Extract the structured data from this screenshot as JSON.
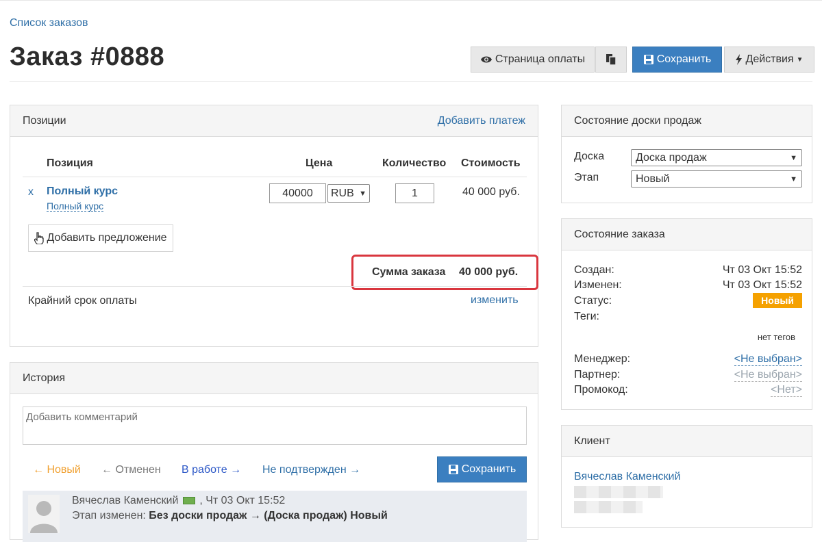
{
  "breadcrumb": "Список заказов",
  "title": "Заказ #0888",
  "toolbar": {
    "pay_page": "Страница оплаты",
    "save": "Сохранить",
    "actions": "Действия"
  },
  "positions": {
    "header": "Позиции",
    "add_payment": "Добавить платеж",
    "columns": {
      "item": "Позиция",
      "price": "Цена",
      "qty": "Количество",
      "cost": "Стоимость"
    },
    "rows": [
      {
        "remove": "x",
        "name": "Полный курс",
        "sub": "Полный курс",
        "price": "40000",
        "currency": "RUB",
        "qty": "1",
        "cost": "40 000 руб."
      }
    ],
    "add_offer": "Добавить предложение",
    "sum_label": "Сумма заказа",
    "sum_value": "40 000 руб.",
    "deadline_label": "Крайний срок оплаты",
    "deadline_edit": "изменить"
  },
  "history": {
    "header": "История",
    "comment_placeholder": "Добавить комментарий",
    "transitions": [
      {
        "label": "← Новый",
        "color": "#f0a030"
      },
      {
        "label": "← Отменен",
        "color": "#777777"
      },
      {
        "label": "В работе →",
        "color": "#2a56c6"
      },
      {
        "label": "Не подтвержден →",
        "color": "#2f6fa7"
      }
    ],
    "save": "Сохранить",
    "entry": {
      "author": "Вячеслав Каменский",
      "date": ", Чт 03 Окт 15:52",
      "prefix": "Этап изменен:",
      "change": "Без доски продаж → (Доска продаж) Новый"
    }
  },
  "board_state": {
    "header": "Состояние доски продаж",
    "board_label": "Доска",
    "board_value": "Доска продаж",
    "stage_label": "Этап",
    "stage_value": "Новый"
  },
  "order_state": {
    "header": "Состояние заказа",
    "created_label": "Создан:",
    "created_value": "Чт 03 Окт 15:52",
    "changed_label": "Изменен:",
    "changed_value": "Чт 03 Окт 15:52",
    "status_label": "Статус:",
    "status_value": "Новый",
    "tags_label": "Теги:",
    "no_tags": "нет тегов",
    "manager_label": "Менеджер:",
    "manager_value": "<Не выбран>",
    "partner_label": "Партнер:",
    "partner_value": "<Не выбран>",
    "promo_label": "Промокод:",
    "promo_value": "<Нет>"
  },
  "client": {
    "header": "Клиент",
    "name": "Вячеслав Каменский"
  },
  "colors": {
    "primary": "#3b7fc0",
    "link": "#2f6fa7",
    "badge": "#f5a100",
    "highlight": "#d9363e"
  }
}
